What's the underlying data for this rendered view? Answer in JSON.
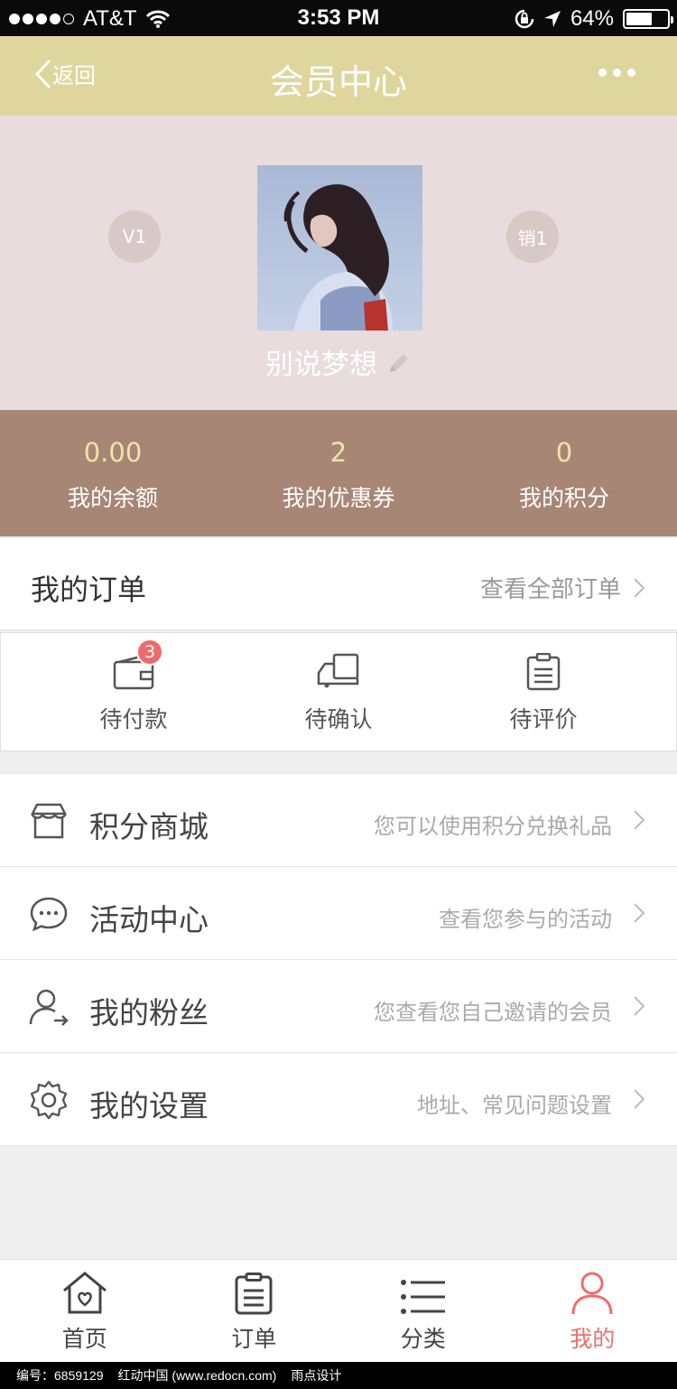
{
  "status_bar": {
    "carrier": "AT&T",
    "time": "3:53 PM",
    "battery": "64%",
    "battery_level": 0.64
  },
  "nav": {
    "back_label": "返回",
    "title": "会员中心",
    "more_icon": "more-icon"
  },
  "profile": {
    "level_left": "V1",
    "level_right": "销1",
    "username": "别说梦想",
    "edit_icon": "pencil-icon"
  },
  "stats": [
    {
      "value": "0.00",
      "label": "我的余额"
    },
    {
      "value": "2",
      "label": "我的优惠券"
    },
    {
      "value": "0",
      "label": "我的积分"
    }
  ],
  "orders": {
    "title": "我的订单",
    "view_all": "查看全部订单",
    "statuses": [
      {
        "label": "待付款",
        "icon": "wallet-icon",
        "badge": "3"
      },
      {
        "label": "待确认",
        "icon": "truck-icon"
      },
      {
        "label": "待评价",
        "icon": "clipboard-icon"
      }
    ]
  },
  "menu": [
    {
      "label": "积分商城",
      "desc": "您可以使用积分兑换礼品",
      "icon": "shop-icon"
    },
    {
      "label": "活动中心",
      "desc": "查看您参与的活动",
      "icon": "chat-icon"
    },
    {
      "label": "我的粉丝",
      "desc": "您查看您自己邀请的会员",
      "icon": "user-share-icon"
    },
    {
      "label": "我的设置",
      "desc": "地址、常见问题设置",
      "icon": "gear-icon"
    }
  ],
  "tabs": [
    {
      "label": "首页",
      "icon": "home-icon",
      "active": false
    },
    {
      "label": "订单",
      "icon": "order-list-icon",
      "active": false
    },
    {
      "label": "分类",
      "icon": "category-list-icon",
      "active": false
    },
    {
      "label": "我的",
      "icon": "person-icon",
      "active": true
    }
  ],
  "colors": {
    "nav_bg": "#dfd69e",
    "profile_bg": "#e8dcdc",
    "stats_bg": "#a88675",
    "stat_value": "#efe4a6",
    "accent": "#ee6e6e"
  },
  "watermark": {
    "id_text": "编号：6859129",
    "site_text": "红动中国 (www.redocn.com)",
    "author_text": "雨点设计"
  }
}
